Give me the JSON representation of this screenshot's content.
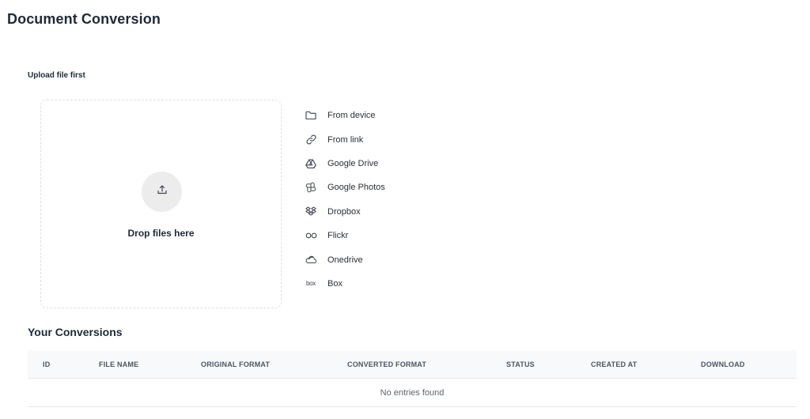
{
  "page": {
    "title": "Document Conversion"
  },
  "upload": {
    "label": "Upload file first",
    "dropzone_text": "Drop files here",
    "sources": [
      {
        "label": "From device",
        "icon": "folder-icon"
      },
      {
        "label": "From link",
        "icon": "link-icon"
      },
      {
        "label": "Google Drive",
        "icon": "google-drive-icon"
      },
      {
        "label": "Google Photos",
        "icon": "google-photos-icon"
      },
      {
        "label": "Dropbox",
        "icon": "dropbox-icon"
      },
      {
        "label": "Flickr",
        "icon": "flickr-icon"
      },
      {
        "label": "Onedrive",
        "icon": "onedrive-icon"
      },
      {
        "label": "Box",
        "icon": "box-icon",
        "glyph": "box"
      }
    ]
  },
  "conversions": {
    "title": "Your Conversions",
    "columns": [
      "ID",
      "FILE NAME",
      "ORIGINAL FORMAT",
      "CONVERTED FORMAT",
      "STATUS",
      "CREATED AT",
      "DOWNLOAD"
    ],
    "empty_text": "No entries found"
  }
}
